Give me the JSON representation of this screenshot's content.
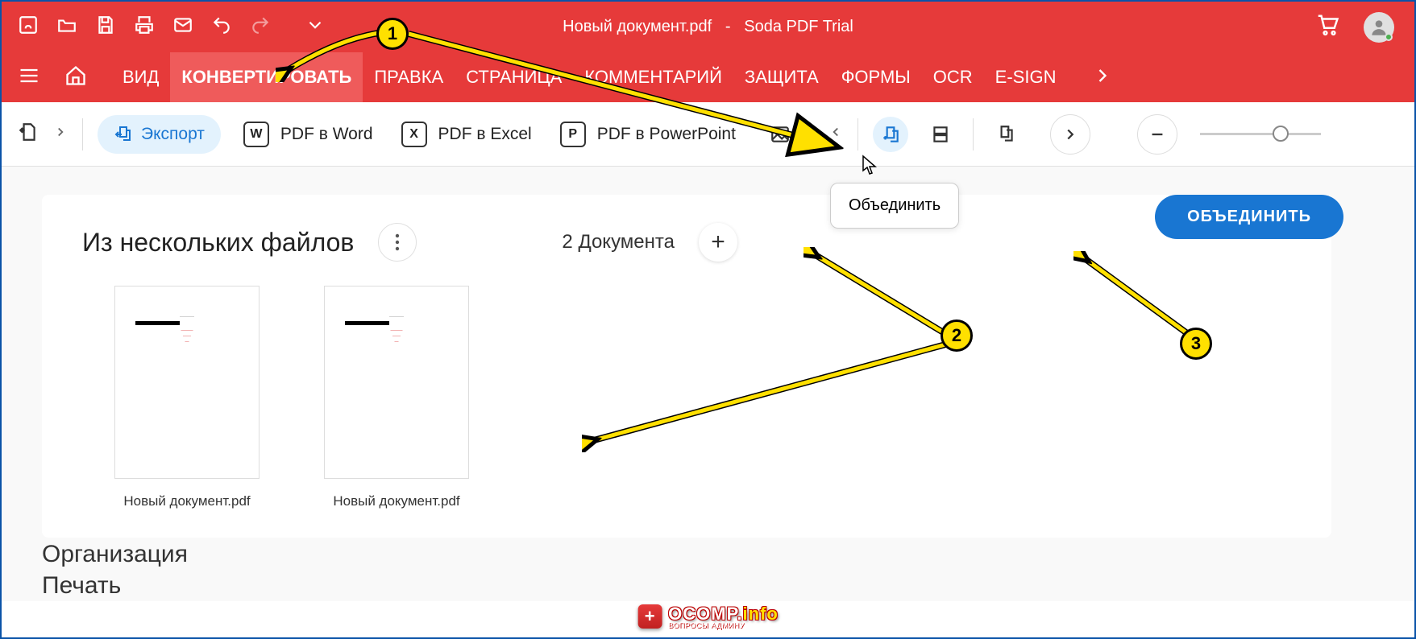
{
  "titlebar": {
    "doc_name": "Новый документ.pdf",
    "sep": "-",
    "app_name": "Soda PDF Trial"
  },
  "menu": {
    "items": [
      "ВИД",
      "КОНВЕРТИРОВАТЬ",
      "ПРАВКА",
      "СТРАНИЦА",
      "КОММЕНТАРИЙ",
      "ЗАЩИТА",
      "ФОРМЫ",
      "OCR",
      "E-SIGN"
    ],
    "active_index": 1
  },
  "subtoolbar": {
    "export_label": "Экспорт",
    "items": [
      {
        "icon_letter": "W",
        "label": "PDF в Word"
      },
      {
        "icon_letter": "X",
        "label": "PDF в Excel"
      },
      {
        "icon_letter": "P",
        "label": "PDF в PowerPoint"
      }
    ]
  },
  "tooltip": {
    "merge": "Объединить"
  },
  "content": {
    "title": "Из нескольких файлов",
    "doc_count_label": "2 Документа",
    "merge_button": "ОБЪЕДИНИТЬ",
    "thumbs": [
      {
        "label": "Новый документ.pdf"
      },
      {
        "label": "Новый документ.pdf"
      }
    ],
    "peek_lines": [
      "Организация",
      "Печать"
    ]
  },
  "watermark": {
    "main": "OCOMP.",
    "suffix": "info",
    "sub": "ВОПРОСЫ АДМИНУ"
  },
  "badges": [
    "1",
    "2",
    "3"
  ]
}
